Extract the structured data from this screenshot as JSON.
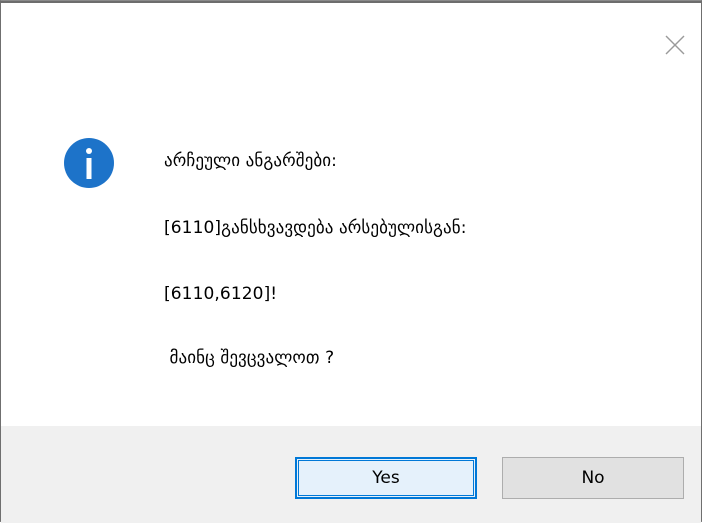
{
  "dialog": {
    "message_lines": [
      "არჩეული ანგარშები:",
      "[6110]განსხვავდება არსებულისგან:",
      "[6110,6120]!",
      " მაინც შევცვალოთ ?"
    ],
    "icons": {
      "info": "info-icon",
      "close": "close-icon"
    }
  },
  "buttons": {
    "yes_label": "Yes",
    "no_label": "No"
  },
  "colors": {
    "info_icon": "#1d73c9",
    "accent": "#0078d7",
    "footer_bg": "#f0f0f0"
  }
}
